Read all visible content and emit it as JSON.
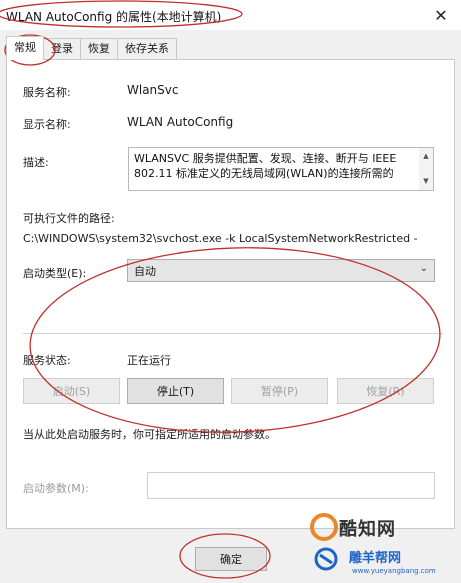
{
  "window": {
    "title": "WLAN AutoConfig 的属性(本地计算机)",
    "close_glyph": "✕"
  },
  "tabs": [
    {
      "label": "常规"
    },
    {
      "label": "登录"
    },
    {
      "label": "恢复"
    },
    {
      "label": "依存关系"
    }
  ],
  "general": {
    "service_name_label": "服务名称:",
    "service_name_value": "WlanSvc",
    "display_name_label": "显示名称:",
    "display_name_value": "WLAN AutoConfig",
    "description_label": "描述:",
    "description_value": "WLANSVC 服务提供配置、发现、连接、断开与 IEEE 802.11 标准定义的无线局域网(WLAN)的连接所需的",
    "exe_path_label": "可执行文件的路径:",
    "exe_path_value": "C:\\WINDOWS\\system32\\svchost.exe -k LocalSystemNetworkRestricted -",
    "startup_type_label": "启动类型(E):",
    "startup_type_value": "自动",
    "service_status_label": "服务状态:",
    "service_status_value": "正在运行",
    "start_button": "启动(S)",
    "stop_button": "停止(T)",
    "pause_button": "暂停(P)",
    "resume_button": "恢复(R)",
    "hint_text": "当从此处启动服务时，你可指定所适用的启动参数。",
    "start_params_label": "启动参数(M):",
    "start_params_value": ""
  },
  "footer": {
    "ok_button": "确定"
  },
  "watermark": {
    "brand": "酷知网",
    "brand2": "雕羊帮网",
    "url": "www.yueyangbang.com"
  },
  "colors": {
    "annotation_red": "#c0302a",
    "watermark_blue": "#1e63c8",
    "watermark_orange": "#e8872b"
  }
}
